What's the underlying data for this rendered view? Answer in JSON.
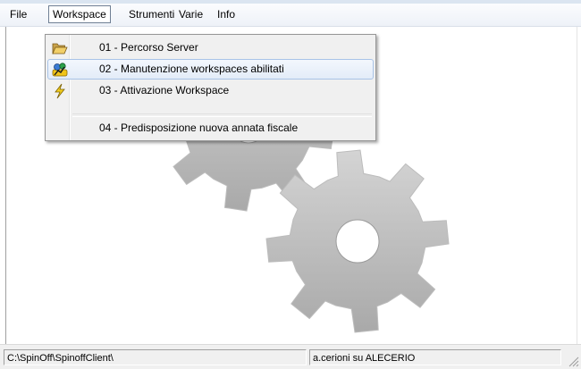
{
  "menubar": {
    "items": [
      {
        "label": "File"
      },
      {
        "label": "Workspace"
      },
      {
        "label": "Strumenti"
      },
      {
        "label": "Varie"
      },
      {
        "label": "Info"
      }
    ]
  },
  "workspace_menu": {
    "items": [
      {
        "label": "01 - Percorso Server",
        "icon": "open-folder-icon"
      },
      {
        "label": "02 - Manutenzione workspaces abilitati",
        "icon": "users-icon"
      },
      {
        "label": "03 - Attivazione Workspace",
        "icon": "lightning-icon"
      },
      {
        "label": "04 - Predisposizione nuova annata fiscale",
        "icon": ""
      }
    ]
  },
  "statusbar": {
    "path": "C:\\SpinOff\\SpinoffClient\\",
    "user": "a.cerioni su ALECERIO"
  },
  "colors": {
    "gear_light": "#d4d4d4",
    "gear_dark": "#a9a9a9",
    "highlight_border": "#a8c3e7"
  }
}
